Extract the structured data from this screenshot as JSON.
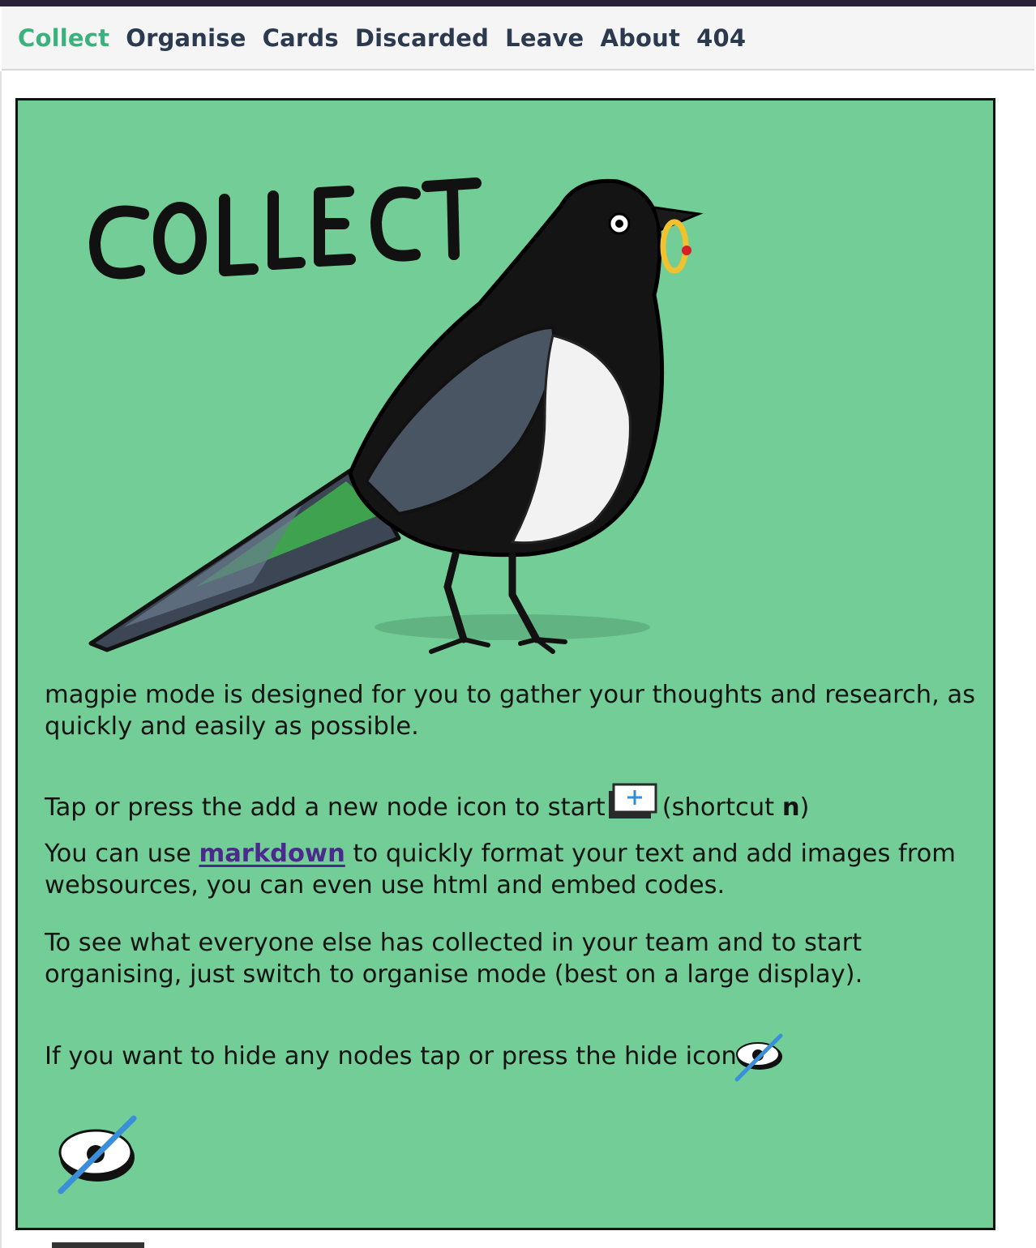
{
  "nav": {
    "items": [
      {
        "label": "Collect",
        "active": true
      },
      {
        "label": "Organise"
      },
      {
        "label": "Cards"
      },
      {
        "label": "Discarded"
      },
      {
        "label": "Leave"
      },
      {
        "label": "About"
      },
      {
        "label": "404"
      }
    ]
  },
  "hero": {
    "lettering": "COLLECT",
    "image_subject": "magpie holding a gold ring"
  },
  "content": {
    "intro": "magpie mode is designed for you to gather your thoughts and research, as quickly and easily as possible.",
    "add_node_prefix": "Tap or press the add a new node icon to start",
    "add_node_shortcut_prefix": "(shortcut ",
    "add_node_shortcut_key": "n",
    "add_node_shortcut_suffix": ")",
    "markdown_prefix": "You can use ",
    "markdown_link": "markdown",
    "markdown_suffix": " to quickly format your text and add images from websources, you can even use html and embed codes.",
    "organise_text": "To see what everyone else has collected in your team and to start organising, just switch to organise mode (best on a large display).",
    "hide_text": "If you want to hide any nodes tap or press the hide icon"
  },
  "icons": {
    "add_node": "add-node-icon",
    "hide": "hide-eye-icon"
  },
  "colors": {
    "accent_active_nav": "#3bb27d",
    "nav_text": "#2c3a4f",
    "card_background": "#72ce96",
    "link": "#4a2a8c",
    "hide_slash": "#3a8fd8"
  }
}
